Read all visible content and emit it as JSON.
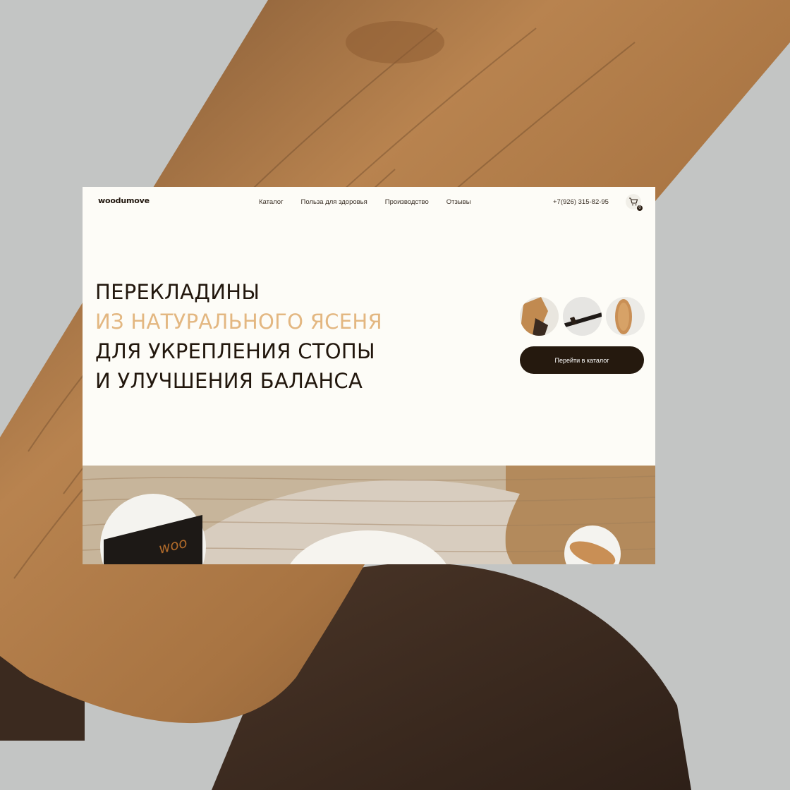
{
  "brand": {
    "logo_text": "woodumove"
  },
  "nav": {
    "items": [
      {
        "label": "Каталог"
      },
      {
        "label": "Польза для здоровья"
      },
      {
        "label": "Производство"
      },
      {
        "label": "Отзывы"
      }
    ]
  },
  "contact": {
    "phone": "+7(926) 315-82-95"
  },
  "cart": {
    "count": "0",
    "icon": "cart-icon"
  },
  "hero": {
    "line1": "ПЕРЕКЛАДИНЫ",
    "line2": "ИЗ НАТУРАЛЬНОГО ЯСЕНЯ",
    "line3": "ДЛЯ УКРЕПЛЕНИЯ СТОПЫ",
    "line4": "И УЛУЧШЕНИЯ БАЛАНСА",
    "cta_label": "Перейти в каталог"
  },
  "colors": {
    "background_cream": "#fdfcf7",
    "accent_gold": "#e3b781",
    "dark_brown": "#25190e"
  }
}
